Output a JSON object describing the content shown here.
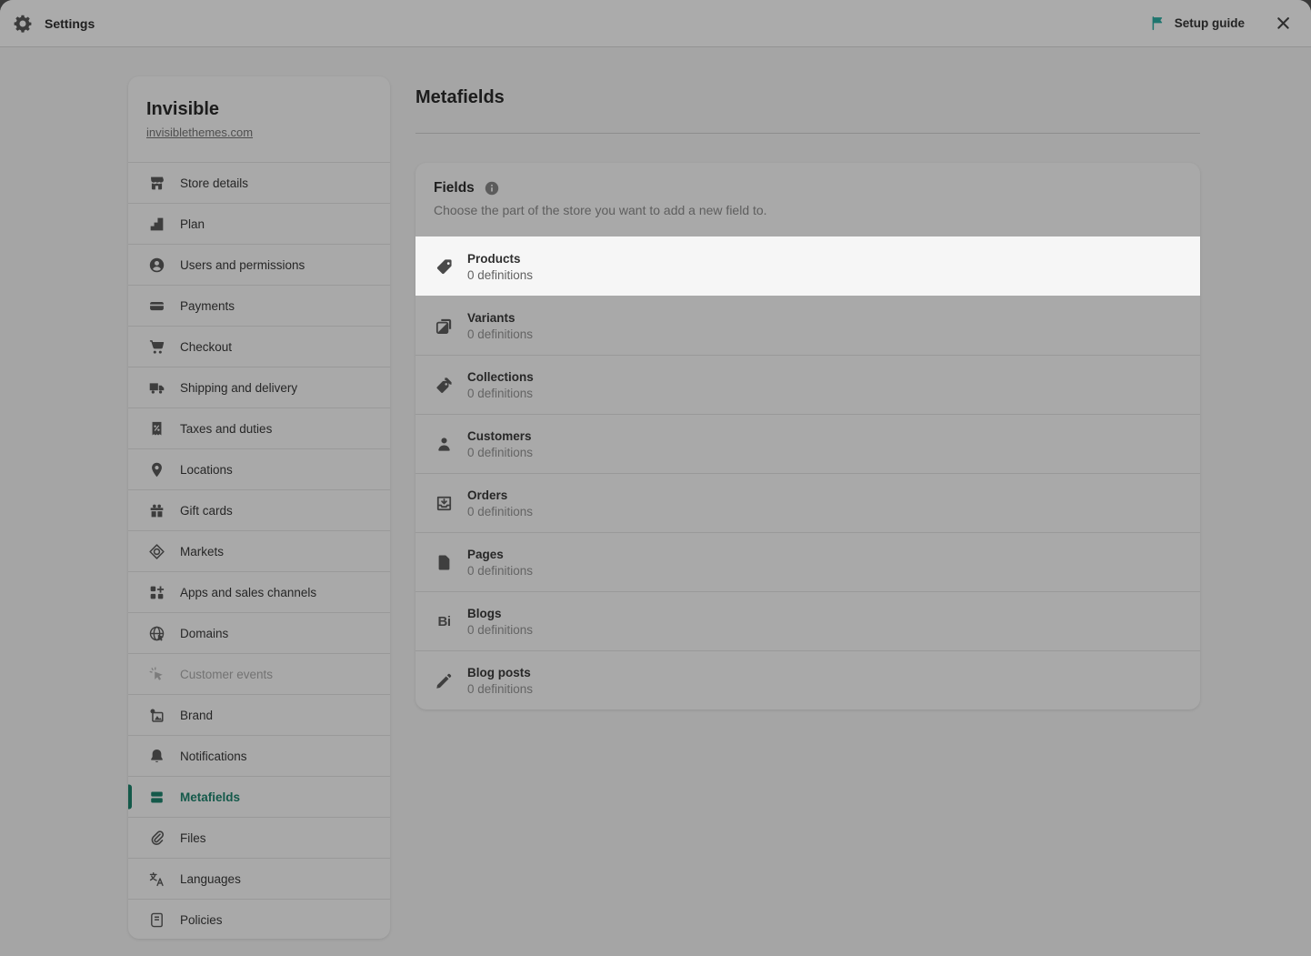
{
  "topbar": {
    "title": "Settings",
    "setup_guide_label": "Setup guide"
  },
  "colors": {
    "selected_green": "#14594a",
    "flag_teal": "#1e756e"
  },
  "sidebar": {
    "store_name": "Invisible",
    "store_domain": "invisiblethemes.com",
    "items": [
      {
        "label": "Store details",
        "icon": "storefront"
      },
      {
        "label": "Plan",
        "icon": "plan-steps"
      },
      {
        "label": "Users and permissions",
        "icon": "user-circle"
      },
      {
        "label": "Payments",
        "icon": "credit-card"
      },
      {
        "label": "Checkout",
        "icon": "cart"
      },
      {
        "label": "Shipping and delivery",
        "icon": "truck"
      },
      {
        "label": "Taxes and duties",
        "icon": "receipt-percent"
      },
      {
        "label": "Locations",
        "icon": "map-pin"
      },
      {
        "label": "Gift cards",
        "icon": "gift-card"
      },
      {
        "label": "Markets",
        "icon": "markets-compass"
      },
      {
        "label": "Apps and sales channels",
        "icon": "apps-grid-plus"
      },
      {
        "label": "Domains",
        "icon": "globe-cursor"
      },
      {
        "label": "Customer events",
        "icon": "cursor-sparkle",
        "muted": true
      },
      {
        "label": "Brand",
        "icon": "brand-image"
      },
      {
        "label": "Notifications",
        "icon": "bell"
      },
      {
        "label": "Metafields",
        "icon": "metafields-stack",
        "selected": true
      },
      {
        "label": "Files",
        "icon": "paperclip"
      },
      {
        "label": "Languages",
        "icon": "translate"
      },
      {
        "label": "Policies",
        "icon": "policy-scroll"
      }
    ]
  },
  "main": {
    "title": "Metafields",
    "fields_card": {
      "title": "Fields",
      "subtitle": "Choose the part of the store you want to add a new field to.",
      "rows": [
        {
          "label": "Products",
          "count": "0 definitions",
          "icon": "tag",
          "highlighted": true
        },
        {
          "label": "Variants",
          "count": "0 definitions",
          "icon": "variants-squares"
        },
        {
          "label": "Collections",
          "count": "0 definitions",
          "icon": "collection-tags"
        },
        {
          "label": "Customers",
          "count": "0 definitions",
          "icon": "person"
        },
        {
          "label": "Orders",
          "count": "0 definitions",
          "icon": "order-box-arrow"
        },
        {
          "label": "Pages",
          "count": "0 definitions",
          "icon": "page-file"
        },
        {
          "label": "Blogs",
          "count": "0 definitions",
          "icon": "blogs-bi"
        },
        {
          "label": "Blog posts",
          "count": "0 definitions",
          "icon": "pencil"
        }
      ]
    }
  }
}
